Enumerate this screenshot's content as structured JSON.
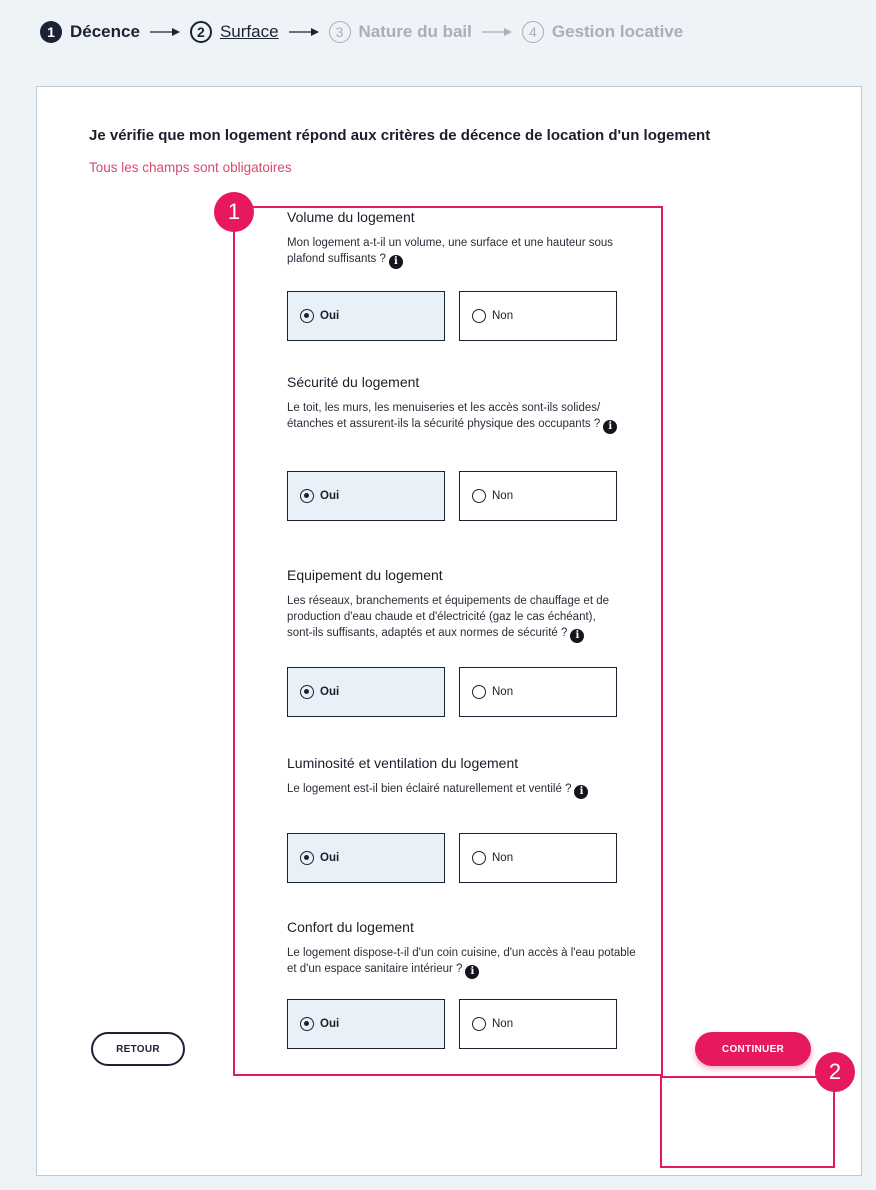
{
  "stepper": {
    "steps": [
      {
        "number": "1",
        "label": "Décence"
      },
      {
        "number": "2",
        "label": "Surface"
      },
      {
        "number": "3",
        "label": "Nature du bail"
      },
      {
        "number": "4",
        "label": "Gestion locative"
      }
    ]
  },
  "form": {
    "intro": "Je vérifie que mon logement répond aux critères de décence de location d'un logement",
    "required_note": "Tous les champs sont obligatoires",
    "questions": [
      {
        "title": "Volume du logement",
        "text": "Mon logement a-t-il un volume, une surface et une hauteur sous plafond suffisants ?",
        "yes": "Oui",
        "no": "Non"
      },
      {
        "title": "Sécurité du logement",
        "text": "Le toit, les murs, les menuiseries et les accès sont-ils solides/étanches et assurent-ils la sécurité physique des occupants ?",
        "yes": "Oui",
        "no": "Non"
      },
      {
        "title": "Equipement du logement",
        "text": "Les réseaux, branchements et équipements de chauffage et de production d'eau chaude et d'électricité (gaz le cas échéant), sont-ils suffisants, adaptés et aux normes de sécurité ?",
        "yes": "Oui",
        "no": "Non"
      },
      {
        "title": "Luminosité et ventilation du logement",
        "text": "Le logement est-il bien éclairé naturellement et ventilé ?",
        "yes": "Oui",
        "no": "Non"
      },
      {
        "title": "Confort du logement",
        "text": "Le logement dispose-t-il d'un coin cuisine, d'un accès à l'eau potable et d'un espace sanitaire intérieur ?",
        "yes": "Oui",
        "no": "Non"
      }
    ],
    "info_glyph": "i",
    "back_label": "RETOUR",
    "continue_label": "CONTINUER"
  },
  "annotations": {
    "badge_1": "1",
    "badge_2": "2"
  },
  "colors": {
    "accent": "#e5195c",
    "navy": "#1d2233",
    "page_bg": "#eef3f8"
  }
}
